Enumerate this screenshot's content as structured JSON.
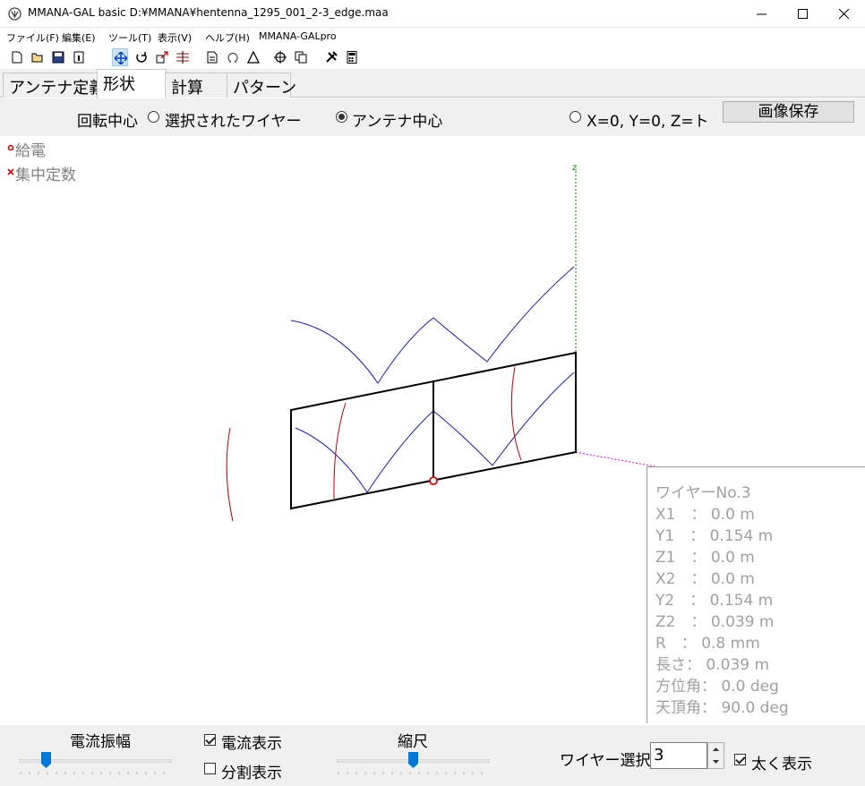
{
  "window": {
    "title": "MMANA-GAL basic D:¥MMANA¥hentenna_1295_001_2-3_edge.maa"
  },
  "menu": [
    "ファイル(F)",
    "編集(E)",
    "ツール(T)",
    "表示(V)",
    "ヘルプ(H)",
    "MMANA-GALpro"
  ],
  "tabs": [
    "アンテナ定義",
    "形状",
    "計算",
    "パターン"
  ],
  "active_tab": "形状",
  "options": {
    "rotation_label": "回転中心",
    "radio_selected_wire": "選択されたワイヤー",
    "radio_antenna_center": "アンテナ中心",
    "radio_origin": "X=0, Y=0, Z=ト",
    "selected": "アンテナ中心",
    "save_image": "画像保存"
  },
  "legend": {
    "feed": "給電",
    "lumped": "集中定数"
  },
  "wire_info": {
    "title": "ワイヤーNo.3",
    "x1": "X1　：  0.0 m",
    "y1": "Y1　：  0.154 m",
    "z1": "Z1　：  0.0 m",
    "x2": "X2　：  0.0 m",
    "y2": "Y2　：  0.154 m",
    "z2": "Z2　：  0.039 m",
    "r": "R　：  0.8 mm",
    "length": "長さ：  0.039 m",
    "azimuth": "方位角：  0.0 deg",
    "zenith": "天頂角：  90.0 deg"
  },
  "axis_labels": {
    "x": "x",
    "z": "z"
  },
  "bottom": {
    "current_amplitude": "電流振幅",
    "show_current": "電流表示",
    "show_current_checked": true,
    "show_segments": "分割表示",
    "show_segments_checked": false,
    "scale": "縮尺",
    "wire_select": "ワイヤー選択",
    "wire_select_value": "3",
    "bold_display": "太く表示",
    "bold_display_checked": true
  },
  "colors": {
    "current_blue": "#1c1caa",
    "current_red": "#c00000",
    "axis_green": "#008000",
    "axis_magenta": "#e000e0",
    "feed_red": "#e00000"
  }
}
